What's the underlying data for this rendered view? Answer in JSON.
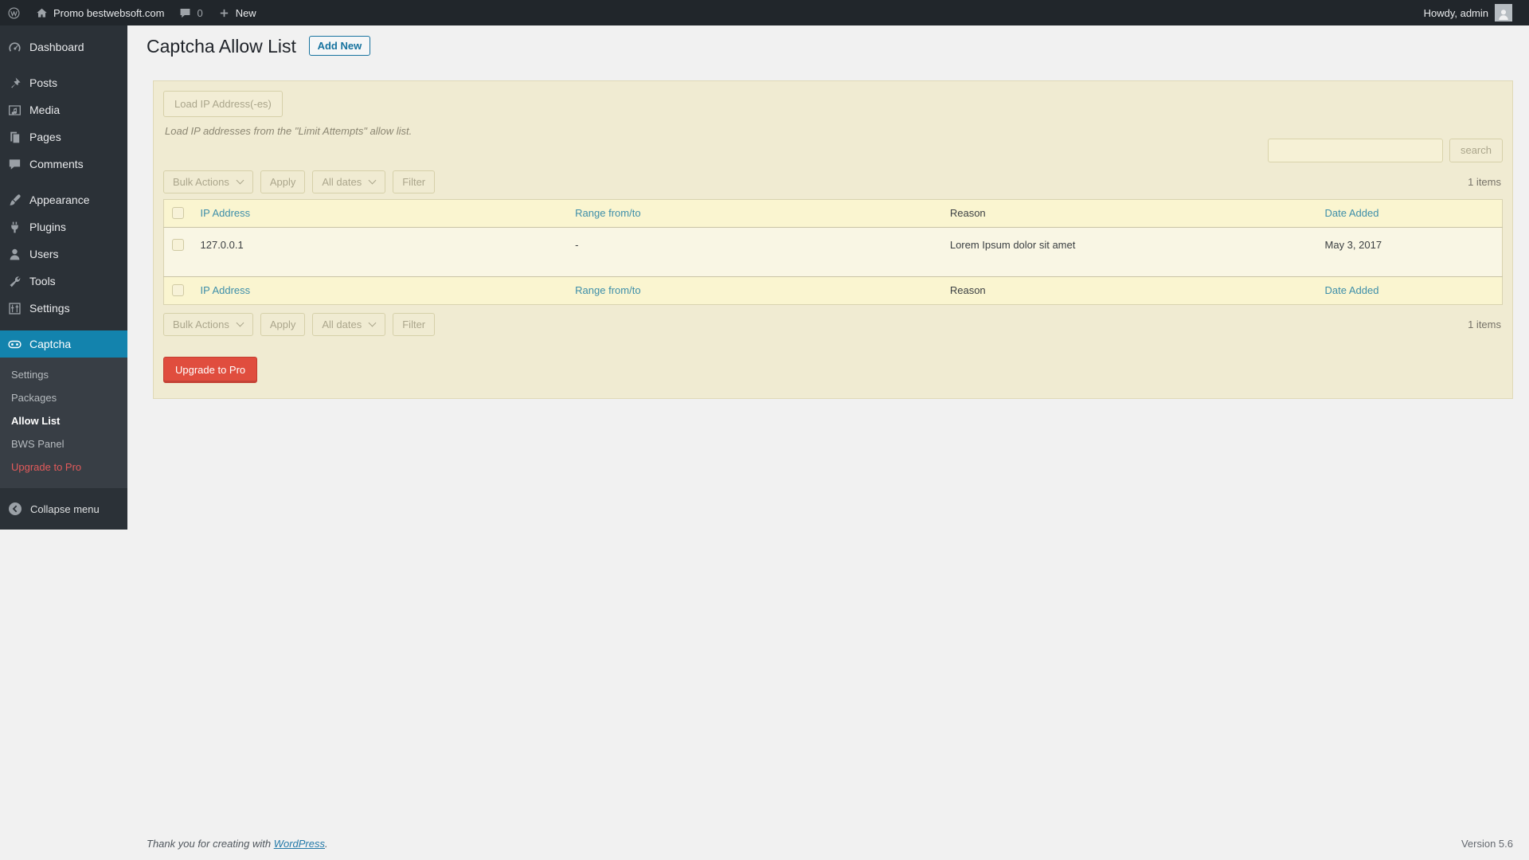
{
  "admin_bar": {
    "site_name": "Promo bestwebsoft.com",
    "comments_count": "0",
    "new_label": "New",
    "howdy": "Howdy, admin"
  },
  "sidebar": {
    "items": [
      {
        "icon": "dashboard-icon",
        "label": "Dashboard"
      },
      {
        "icon": "pin-icon",
        "label": "Posts"
      },
      {
        "icon": "media-icon",
        "label": "Media"
      },
      {
        "icon": "pages-icon",
        "label": "Pages"
      },
      {
        "icon": "comments-icon",
        "label": "Comments"
      },
      {
        "icon": "appearance-icon",
        "label": "Appearance"
      },
      {
        "icon": "plugin-icon",
        "label": "Plugins"
      },
      {
        "icon": "users-icon",
        "label": "Users"
      },
      {
        "icon": "tools-icon",
        "label": "Tools"
      },
      {
        "icon": "settings-icon",
        "label": "Settings"
      },
      {
        "icon": "captcha-icon",
        "label": "Captcha"
      }
    ],
    "captcha_submenu": [
      "Settings",
      "Packages",
      "Allow List",
      "BWS Panel",
      "Upgrade to Pro"
    ],
    "active_item": "Captcha",
    "active_subitem": "Allow List",
    "collapse_label": "Collapse menu"
  },
  "page": {
    "title": "Captcha Allow List",
    "add_new_label": "Add New",
    "load_ip_button": "Load IP Address(-es)",
    "load_ip_hint": "Load IP addresses from the \"Limit Attempts\" allow list.",
    "search_button": "search",
    "search_value": "",
    "items_count": "1 items",
    "bulk_actions_label": "Bulk Actions",
    "apply_label": "Apply",
    "dates_filter_label": "All dates",
    "filter_label": "Filter",
    "upgrade_button": "Upgrade to Pro"
  },
  "table": {
    "columns": [
      "IP Address",
      "Range from/to",
      "Reason",
      "Date Added"
    ],
    "rows": [
      {
        "ip": "127.0.0.1",
        "range": "-",
        "reason": "Lorem Ipsum dolor sit amet",
        "date_added": "May 3, 2017"
      }
    ]
  },
  "footer": {
    "thanks_prefix": "Thank you for creating with ",
    "wordpress_link_label": "WordPress",
    "thanks_suffix": ".",
    "version": "Version 5.6"
  },
  "colors": {
    "admin_bar_bg": "#21262b",
    "sidebar_bg": "#2b3137",
    "submenu_bg": "#383e45",
    "active_menu_blue": "#1383ad",
    "submenu_upgrade_red": "#e35b5b",
    "panel_background": "#f0ebd2",
    "table_header_bg": "#faf5d0",
    "table_row_bg": "#f9f6e4",
    "header_link_teal": "#3d8ea9",
    "upgrade_button_red": "#e04d3e",
    "add_new_blue": "#17739f"
  }
}
